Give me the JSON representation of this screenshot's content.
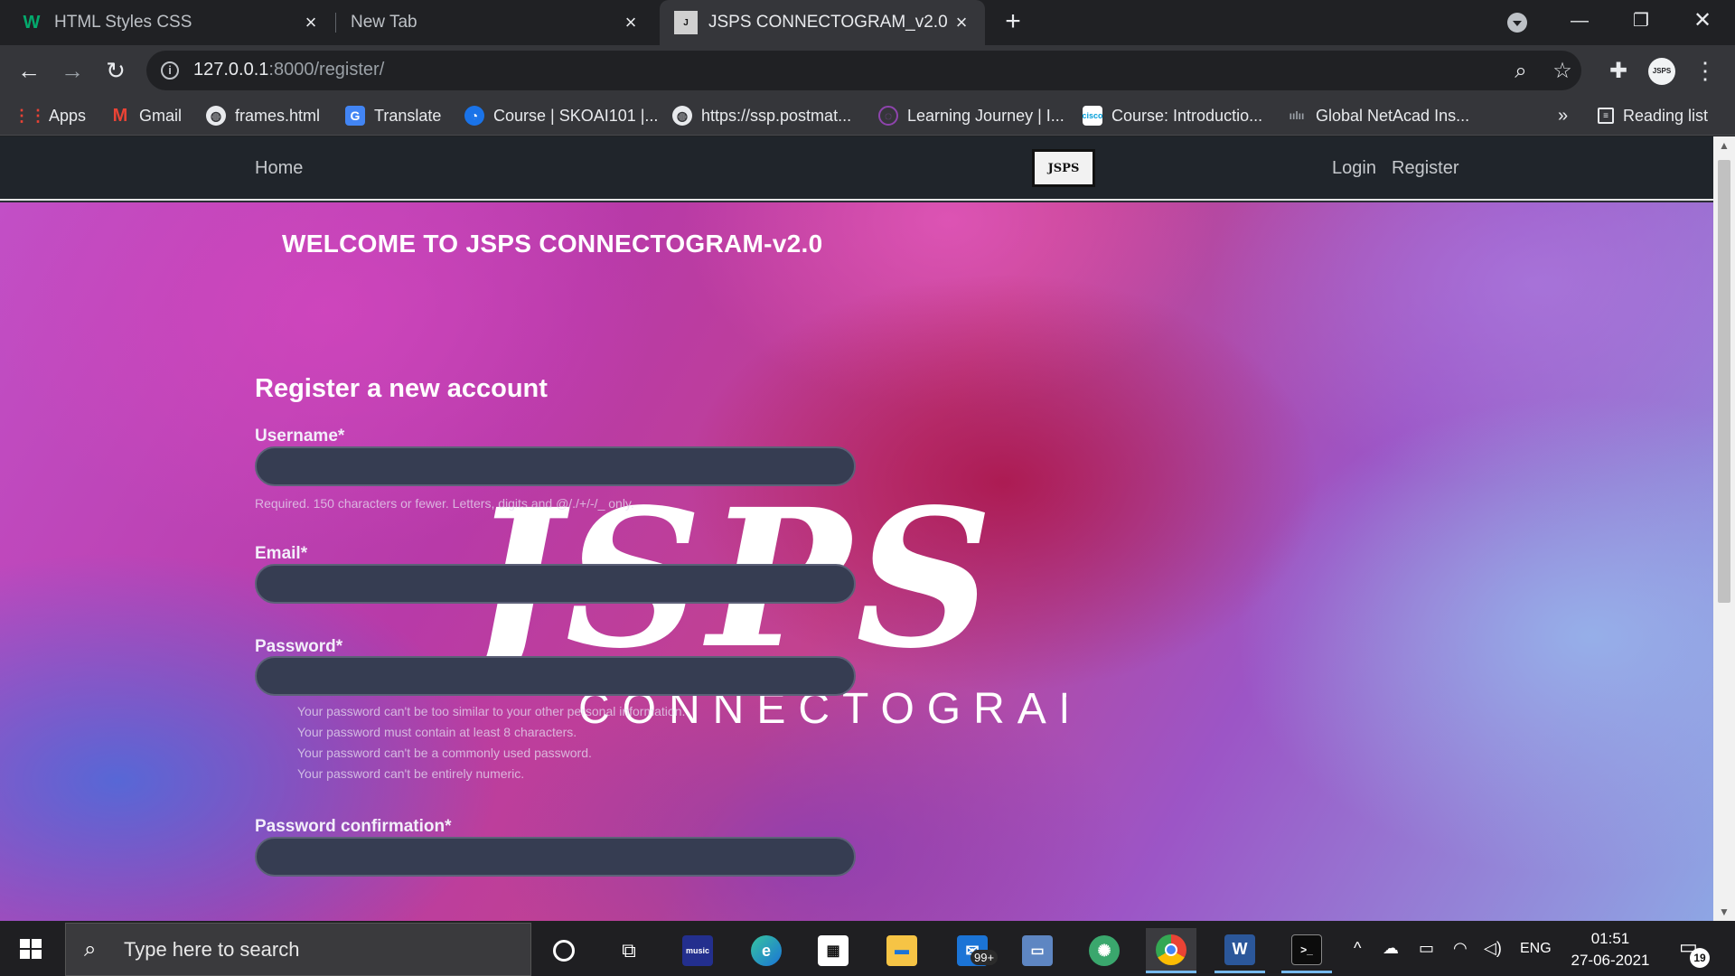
{
  "browser": {
    "tabs": [
      {
        "title": "HTML Styles CSS",
        "icon": "w3schools-icon",
        "active": false
      },
      {
        "title": "New Tab",
        "icon": "",
        "active": false
      },
      {
        "title": "JSPS CONNECTOGRAM_v2.0",
        "icon": "site-favicon",
        "active": true
      }
    ],
    "url_host": "127.0.0.1",
    "url_rest": ":8000/register/",
    "profile_initials": "JSPS"
  },
  "bookmarks": [
    {
      "label": "Apps",
      "icon": "apps-grid-icon"
    },
    {
      "label": "Gmail",
      "icon": "gmail-icon"
    },
    {
      "label": "frames.html",
      "icon": "globe-icon"
    },
    {
      "label": "Translate",
      "icon": "translate-icon"
    },
    {
      "label": "Course | SKOAI101 |...",
      "icon": "course-icon"
    },
    {
      "label": "https://ssp.postmat...",
      "icon": "globe-icon"
    },
    {
      "label": "Learning Journey | I...",
      "icon": "learning-icon"
    },
    {
      "label": "Course: Introductio...",
      "icon": "cisco-icon"
    },
    {
      "label": "Global NetAcad Ins...",
      "icon": "cisco-icon"
    }
  ],
  "bookmarks_overflow": "»",
  "reading_list": "Reading list",
  "site": {
    "nav": {
      "home": "Home",
      "login": "Login",
      "register": "Register",
      "logo_text": "JSPS"
    },
    "welcome": "WELCOME TO JSPS CONNECTOGRAM-v2.0",
    "watermark_big": "JSPS",
    "watermark_small": "CONNECTOGRAM",
    "form": {
      "title": "Register a new account",
      "username_label": "Username*",
      "username_help": "Required. 150 characters or fewer. Letters, digits and @/./+/-/_ only.",
      "email_label": "Email*",
      "password_label": "Password*",
      "password_help": [
        "Your password can't be too similar to your other personal information.",
        "Your password must contain at least 8 characters.",
        "Your password can't be a commonly used password.",
        "Your password can't be entirely numeric."
      ],
      "password_confirm_label": "Password confirmation*"
    }
  },
  "taskbar": {
    "search_placeholder": "Type here to search",
    "mail_badge": "99+",
    "language": "ENG",
    "time": "01:51",
    "date": "27-06-2021",
    "notifications": "19"
  }
}
